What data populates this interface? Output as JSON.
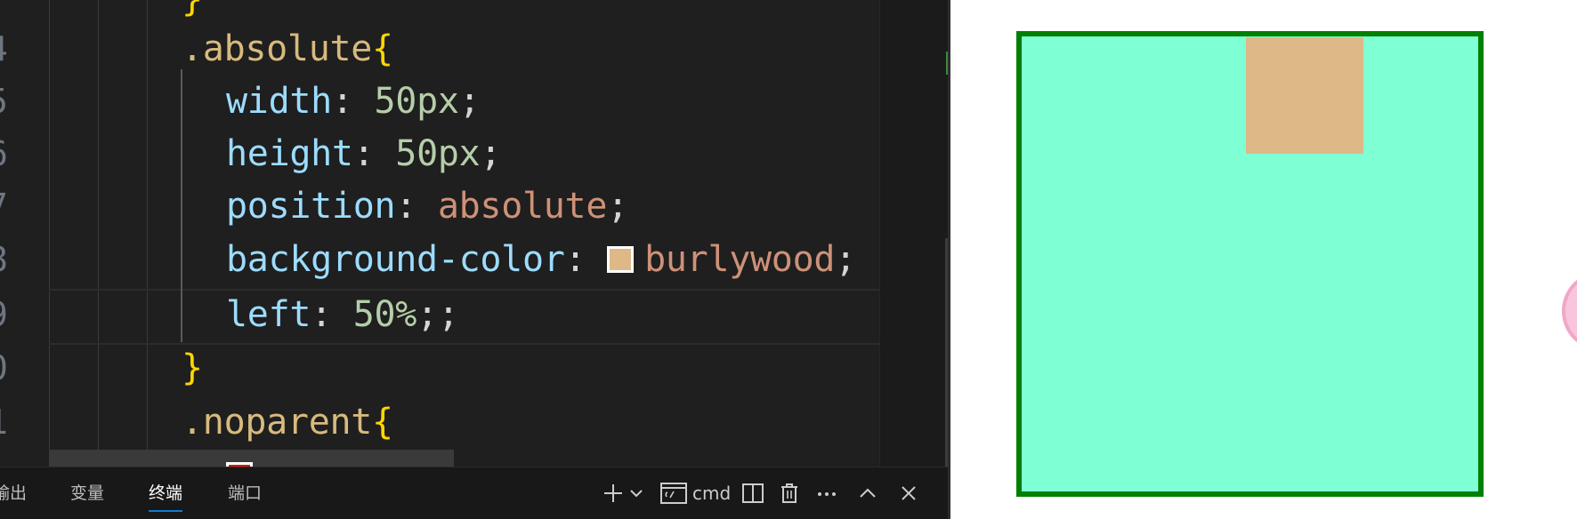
{
  "editor": {
    "line_numbers": [
      "4",
      "5",
      "6",
      "7",
      "8",
      "9",
      "0",
      "1"
    ],
    "code_lines": [
      {
        "tokens": [
          {
            "t": "}",
            "c": "brace"
          }
        ]
      },
      {
        "tokens": [
          {
            "t": ".absolute",
            "c": "sel"
          },
          {
            "t": "{",
            "c": "brace"
          }
        ]
      },
      {
        "tokens": [
          {
            "t": "width",
            "c": "prop"
          },
          {
            "t": ": ",
            "c": "punc"
          },
          {
            "t": "50px",
            "c": "num"
          },
          {
            "t": ";",
            "c": "punc"
          }
        ]
      },
      {
        "tokens": [
          {
            "t": "height",
            "c": "prop"
          },
          {
            "t": ": ",
            "c": "punc"
          },
          {
            "t": "50px",
            "c": "num"
          },
          {
            "t": ";",
            "c": "punc"
          }
        ]
      },
      {
        "tokens": [
          {
            "t": "position",
            "c": "prop"
          },
          {
            "t": ": ",
            "c": "punc"
          },
          {
            "t": "absolute",
            "c": "kw"
          },
          {
            "t": ";",
            "c": "punc"
          }
        ]
      },
      {
        "tokens": [
          {
            "t": "background-color",
            "c": "prop"
          },
          {
            "t": ": ",
            "c": "punc"
          },
          {
            "swatch": "#deb887"
          },
          {
            "t": "burlywood",
            "c": "kw"
          },
          {
            "t": ";",
            "c": "punc"
          }
        ]
      },
      {
        "tokens": [
          {
            "t": "left",
            "c": "prop"
          },
          {
            "t": ": ",
            "c": "punc"
          },
          {
            "t": "50%",
            "c": "num"
          },
          {
            "t": ";;",
            "c": "punc"
          }
        ]
      },
      {
        "tokens": [
          {
            "t": "}",
            "c": "brace"
          }
        ]
      },
      {
        "tokens": [
          {
            "t": ".noparent",
            "c": "sel"
          },
          {
            "t": "{",
            "c": "brace"
          }
        ]
      },
      {
        "tokens": [
          {
            "swatch": "#e51400"
          }
        ]
      }
    ],
    "colors": {
      "background": "#1f1f1f",
      "selector": "#d7ba7d",
      "brace": "#ffd700",
      "property": "#9cdcfe",
      "number": "#b5cea8",
      "keyword_value": "#ce9178"
    }
  },
  "panel": {
    "tabs": [
      {
        "label": "输出",
        "active": false
      },
      {
        "label": "变量",
        "active": false
      },
      {
        "label": "终端",
        "active": true
      },
      {
        "label": "端口",
        "active": false
      }
    ],
    "terminal_name": "cmd",
    "tools": [
      "add-icon",
      "chevron-down-icon",
      "terminal-icon",
      "split-icon",
      "trash-icon",
      "more-icon",
      "chevron-up-icon",
      "close-icon"
    ],
    "accent": "#0e7ad3"
  },
  "preview": {
    "parent_color": "#7fffd4",
    "parent_border": "#008000",
    "child_color": "#deb887"
  }
}
